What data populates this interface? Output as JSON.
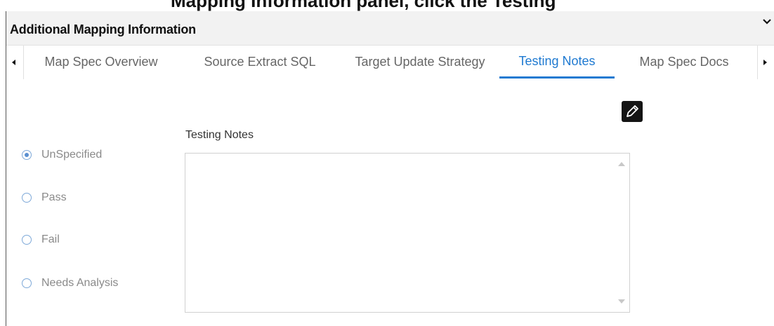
{
  "top_caption": "Mapping Information panel, click the Testing",
  "panel": {
    "title": "Additional Mapping Information",
    "collapse_icon": "chevron-down-icon"
  },
  "tabs": [
    {
      "label": "Map Spec Overview",
      "active": false
    },
    {
      "label": "Source Extract SQL",
      "active": false
    },
    {
      "label": "Target Update Strategy",
      "active": false
    },
    {
      "label": "Testing Notes",
      "active": true
    },
    {
      "label": "Map Spec Docs",
      "active": false
    }
  ],
  "tab_scroll": {
    "left_icon": "caret-left-icon",
    "right_icon": "caret-right-icon"
  },
  "testing_notes": {
    "label": "Testing Notes",
    "value": "",
    "edit_icon": "pencil-edit-icon"
  },
  "status_options": [
    {
      "label": "UnSpecified",
      "checked": true
    },
    {
      "label": "Pass",
      "checked": false
    },
    {
      "label": "Fail",
      "checked": false
    },
    {
      "label": "Needs Analysis",
      "checked": false
    }
  ],
  "colors": {
    "accent": "#1f7ad1",
    "header_bg": "#f2f2f2",
    "radio": "#7da8d8"
  }
}
